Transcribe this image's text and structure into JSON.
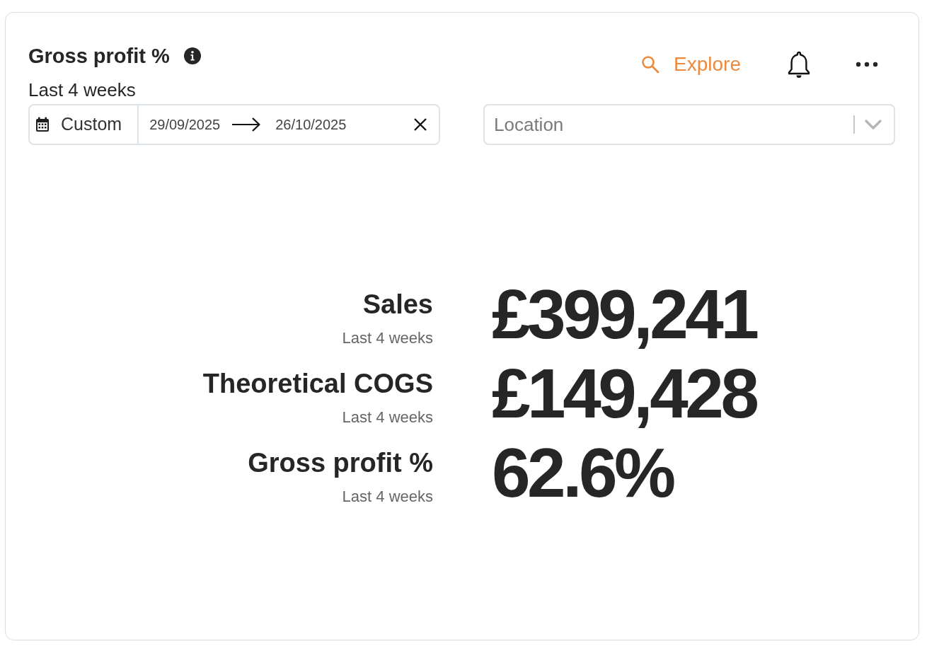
{
  "card": {
    "title": "Gross profit %",
    "subtitle": "Last 4 weeks",
    "explore_label": "Explore",
    "date_filter": {
      "preset": "Custom",
      "start": "29/09/2025",
      "end": "26/10/2025"
    },
    "location_filter": {
      "placeholder": "Location"
    },
    "metrics": [
      {
        "label": "Sales",
        "period": "Last 4 weeks",
        "value": "£399,241"
      },
      {
        "label": "Theoretical COGS",
        "period": "Last 4 weeks",
        "value": "£149,428"
      },
      {
        "label": "Gross profit %",
        "period": "Last 4 weeks",
        "value": "62.6%"
      }
    ]
  }
}
